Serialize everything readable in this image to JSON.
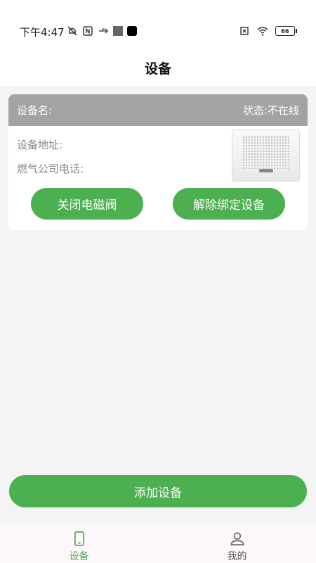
{
  "status_bar": {
    "time": "下午4:47",
    "battery": "66"
  },
  "header": {
    "title": "设备"
  },
  "device_card": {
    "name_label": "设备名:",
    "status_label": "状态:不在线",
    "address_label": "设备地址:",
    "phone_label": "燃气公司电话:",
    "close_valve_label": "关闭电磁阀",
    "unbind_label": "解除绑定设备"
  },
  "add_device_label": "添加设备",
  "tabbar": {
    "tabs": [
      {
        "label": "设备",
        "icon": "phone-icon",
        "active": true
      },
      {
        "label": "我的",
        "icon": "person-icon",
        "active": false
      }
    ]
  },
  "colors": {
    "accent": "#4caf50",
    "card_header": "#a3a3a3"
  }
}
